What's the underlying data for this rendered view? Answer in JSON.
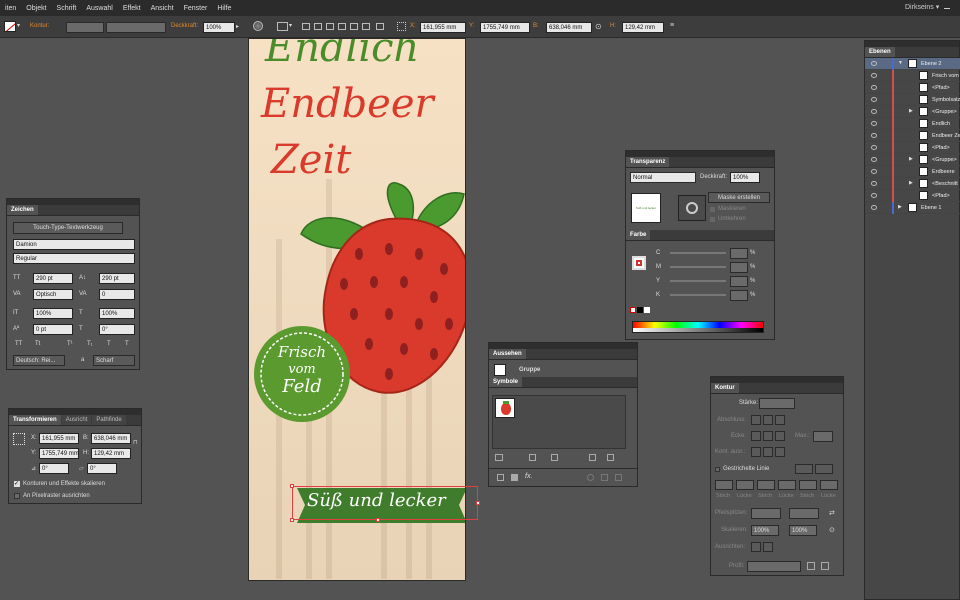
{
  "menubar": {
    "items": [
      "iten",
      "Objekt",
      "Schrift",
      "Auswahl",
      "Effekt",
      "Ansicht",
      "Fenster",
      "Hilfe"
    ],
    "workspace": "Dirkseins"
  },
  "control": {
    "kontur_label": "Kontur:",
    "deckkraft_label": "Deckkraft:",
    "deckkraft_value": "100%",
    "x_label": "X:",
    "x_value": "161,955 mm",
    "y_label": "Y:",
    "y_value": "1755,749 mm",
    "b_label": "B:",
    "b_value": "638,046 mm",
    "h_label": "H:",
    "h_value": "129,42 mm"
  },
  "artwork": {
    "line1": "Endlich",
    "line2": "Endbeer",
    "line3": "Zeit",
    "badge": [
      "Frisch",
      "vom",
      "Feld"
    ],
    "banner": "Süß und lecker",
    "colors": {
      "green": "#4a8c2a",
      "red": "#d93a2b",
      "banner": "#3f7d2c"
    }
  },
  "zeichen": {
    "tab": "Zeichen",
    "touch_button": "Touch-Type-Textwerkzeug",
    "font": "Damion",
    "style": "Regular",
    "size": "290 pt",
    "leading": "290 pt",
    "kerning": "Optisch",
    "tracking": "0",
    "hscale": "100%",
    "vscale": "100%",
    "baseline": "0 pt",
    "rotation": "0°",
    "language": "Deutsch: Rei...",
    "aa_label": "a",
    "aa": "Scharf",
    "type_buttons": [
      "TT",
      "Tt",
      "T¹",
      "T₁",
      "T",
      "T"
    ]
  },
  "transformieren": {
    "tabs": [
      "Transformieren",
      "Ausricht",
      "Pathfinde"
    ],
    "x_label": "X:",
    "x": "161,955 mm",
    "y_label": "Y:",
    "y": "1755,749 mm",
    "b_label": "B:",
    "b": "638,046 mm",
    "h_label": "H:",
    "h": "129,42 mm",
    "angle": "0°",
    "shear": "0°",
    "check1": "Konturen und Effekte skalieren",
    "check2": "An Pixelraster ausrichten"
  },
  "transparenz": {
    "tab": "Transparenz",
    "mode": "Normal",
    "opacity_label": "Deckkraft:",
    "opacity": "100%",
    "mask_button": "Maske erstellen",
    "clip": "Maskieren",
    "invert": "Umkehren",
    "thumb_text": "Süß und lecker"
  },
  "farbe": {
    "tab": "Farbe",
    "channels": [
      "C",
      "M",
      "Y",
      "K"
    ],
    "unit": "%"
  },
  "aussehen": {
    "tab": "Aussehen",
    "group": "Gruppe"
  },
  "symbole": {
    "tab": "Symbole"
  },
  "kontur": {
    "tab": "Kontur",
    "staerke": "Stärke:",
    "abschluss": "Abschluss:",
    "ecke": "Ecke:",
    "max": "Max.:",
    "kont_ausr": "Kont. ausr.:",
    "gestrichelt": "Gestrichelte Linie",
    "dash_labels": [
      "Strich",
      "Lücke",
      "Strich",
      "Lücke",
      "Strich",
      "Lücke"
    ],
    "pfeilspitzen": "Pfeilspitzen:",
    "skalieren": "Skalieren:",
    "scale1": "100%",
    "scale2": "100%",
    "ausrichten": "Ausrichten:",
    "profil": "Profil:"
  },
  "ebenen": {
    "tab": "Ebenen",
    "rows": [
      {
        "name": "Ebene 2",
        "indent": 0,
        "color": "#4a6ad0",
        "expand": "▼"
      },
      {
        "name": "Frisch vom",
        "indent": 1,
        "color": "#d05050",
        "expand": ""
      },
      {
        "name": "<Pfad>",
        "indent": 1,
        "color": "#d05050",
        "expand": ""
      },
      {
        "name": "Symbolsatz",
        "indent": 1,
        "color": "#d05050",
        "expand": ""
      },
      {
        "name": "<Gruppe>",
        "indent": 1,
        "color": "#d05050",
        "expand": "▶"
      },
      {
        "name": "Endlich",
        "indent": 1,
        "color": "#d05050",
        "expand": ""
      },
      {
        "name": "Endbeer Ze",
        "indent": 1,
        "color": "#d05050",
        "expand": ""
      },
      {
        "name": "<Pfad>",
        "indent": 1,
        "color": "#d05050",
        "expand": ""
      },
      {
        "name": "<Gruppe>",
        "indent": 1,
        "color": "#d05050",
        "expand": "▶"
      },
      {
        "name": "Erdbeere",
        "indent": 1,
        "color": "#d05050",
        "expand": ""
      },
      {
        "name": "<Beschnitt",
        "indent": 1,
        "color": "#d05050",
        "expand": "▶"
      },
      {
        "name": "<Pfad>",
        "indent": 1,
        "color": "#d05050",
        "expand": ""
      },
      {
        "name": "Ebene 1",
        "indent": 0,
        "color": "#4a6ad0",
        "expand": "▶"
      }
    ]
  }
}
